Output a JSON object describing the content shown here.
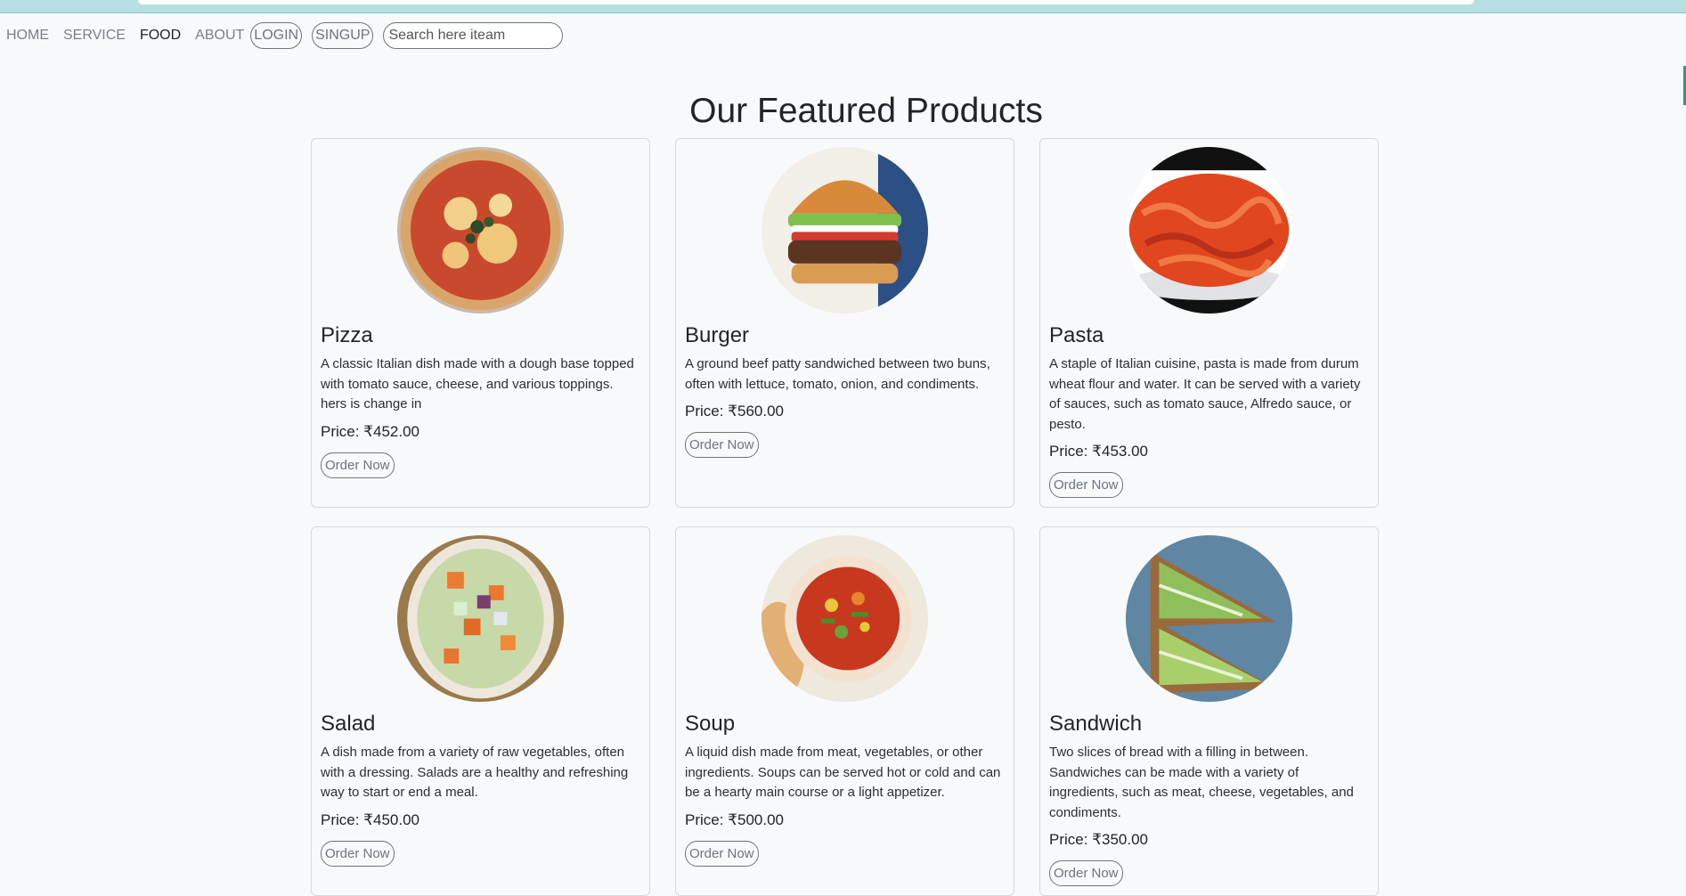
{
  "nav": {
    "home": "HOME",
    "service": "SERVICE",
    "food": "FOOD",
    "about": "ABOUT",
    "login": "LOGIN",
    "signup": "SINGUP",
    "search_placeholder": "Search here iteam"
  },
  "page_title": "Our Featured Products",
  "order_label": "Order Now",
  "products": [
    {
      "name": "Pizza",
      "description": "A classic Italian dish made with a dough base topped with tomato sauce, cheese, and various toppings. hers is change in",
      "price": "Price: ₹452.00",
      "image_icon": "pizza-image"
    },
    {
      "name": "Burger",
      "description": "A ground beef patty sandwiched between two buns, often with lettuce, tomato, onion, and condiments.",
      "price": "Price: ₹560.00",
      "image_icon": "burger-image"
    },
    {
      "name": "Pasta",
      "description": "A staple of Italian cuisine, pasta is made from durum wheat flour and water. It can be served with a variety of sauces, such as tomato sauce, Alfredo sauce, or pesto.",
      "price": "Price: ₹453.00",
      "image_icon": "pasta-image"
    },
    {
      "name": "Salad",
      "description": "A dish made from a variety of raw vegetables, often with a dressing. Salads are a healthy and refreshing way to start or end a meal.",
      "price": "Price: ₹450.00",
      "image_icon": "salad-image"
    },
    {
      "name": "Soup",
      "description": "A liquid dish made from meat, vegetables, or other ingredients. Soups can be served hot or cold and can be a hearty main course or a light appetizer.",
      "price": "Price: ₹500.00",
      "image_icon": "soup-image"
    },
    {
      "name": "Sandwich",
      "description": "Two slices of bread with a filling in between. Sandwiches can be made with a variety of ingredients, such as meat, cheese, vegetables, and condiments.",
      "price": "Price: ₹350.00",
      "image_icon": "sandwich-image"
    }
  ],
  "colors": {
    "background": "#f8f9fa",
    "top_strip": "#b7e0e3",
    "border": "#d6d8db",
    "muted": "#6c757d"
  }
}
